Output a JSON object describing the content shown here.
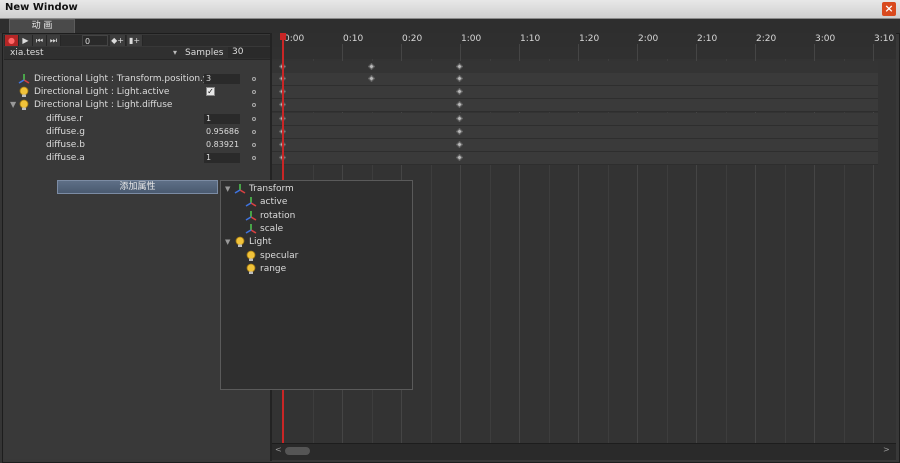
{
  "window": {
    "title": "New Window",
    "close_glyph": "×"
  },
  "tab": {
    "label": "动 画"
  },
  "toolbar": {
    "record_icon": "record-icon",
    "play_icon": "play-icon",
    "prev_icon": "prev-key-icon",
    "next_icon": "next-key-icon",
    "add_key_icon": "add-keyframe-icon",
    "add_event_icon": "add-event-icon",
    "frame": "0",
    "glyph_record": "●",
    "glyph_play": "▶",
    "glyph_prev": "⏮",
    "glyph_next": "⏭",
    "glyph_addkey": "◆+",
    "glyph_event": "▮+"
  },
  "clip": {
    "name": "xia.test",
    "samples_label": "Samples",
    "samples": "30",
    "arrow": "▾"
  },
  "properties": [
    {
      "label": "Directional Light : Transform.position.y",
      "value": "3",
      "kind": "transform",
      "indent": 0
    },
    {
      "label": "Directional Light : Light.active",
      "value": "✓",
      "kind": "light",
      "indent": 0,
      "checkbox": true
    },
    {
      "label": "Directional Light : Light.diffuse",
      "value": "",
      "kind": "light",
      "indent": 0,
      "expanded": true
    },
    {
      "label": "diffuse.r",
      "value": "1",
      "indent": 1
    },
    {
      "label": "diffuse.g",
      "value": "0.95686",
      "indent": 1
    },
    {
      "label": "diffuse.b",
      "value": "0.83921",
      "indent": 1
    },
    {
      "label": "diffuse.a",
      "value": "1",
      "indent": 1
    }
  ],
  "add_property_label": "添加属性",
  "popup": {
    "items": [
      {
        "label": "Transform",
        "icon": "transform-icon",
        "group": true
      },
      {
        "label": "active",
        "icon": "transform-icon",
        "group": false
      },
      {
        "label": "rotation",
        "icon": "transform-icon",
        "group": false
      },
      {
        "label": "scale",
        "icon": "transform-icon",
        "group": false
      },
      {
        "label": "Light",
        "icon": "light-bulb-icon",
        "group": true
      },
      {
        "label": "specular",
        "icon": "light-bulb-icon",
        "group": false
      },
      {
        "label": "range",
        "icon": "light-bulb-icon",
        "group": false
      }
    ]
  },
  "timeline": {
    "ticks": [
      "0:00",
      "0:10",
      "0:20",
      "1:00",
      "1:10",
      "1:20",
      "2:00",
      "2:10",
      "2:20",
      "3:00",
      "3:10"
    ],
    "keyframe_rows": [
      {
        "keys": [
          0,
          10,
          20
        ]
      },
      {
        "keys": [
          0,
          10,
          20
        ]
      },
      {
        "keys": [
          0,
          20
        ]
      },
      {
        "keys": [
          0,
          20
        ]
      },
      {
        "keys": [
          0,
          20
        ]
      },
      {
        "keys": [
          0,
          20
        ]
      },
      {
        "keys": [
          0,
          20
        ]
      },
      {
        "keys": [
          0,
          20
        ]
      }
    ],
    "playhead_frame": 0
  },
  "colors": {
    "accent": "#c92626",
    "panel": "#383838",
    "highlight_button": "#5e6f86"
  },
  "scroll": {
    "left_glyph": "<",
    "right_glyph": ">"
  }
}
